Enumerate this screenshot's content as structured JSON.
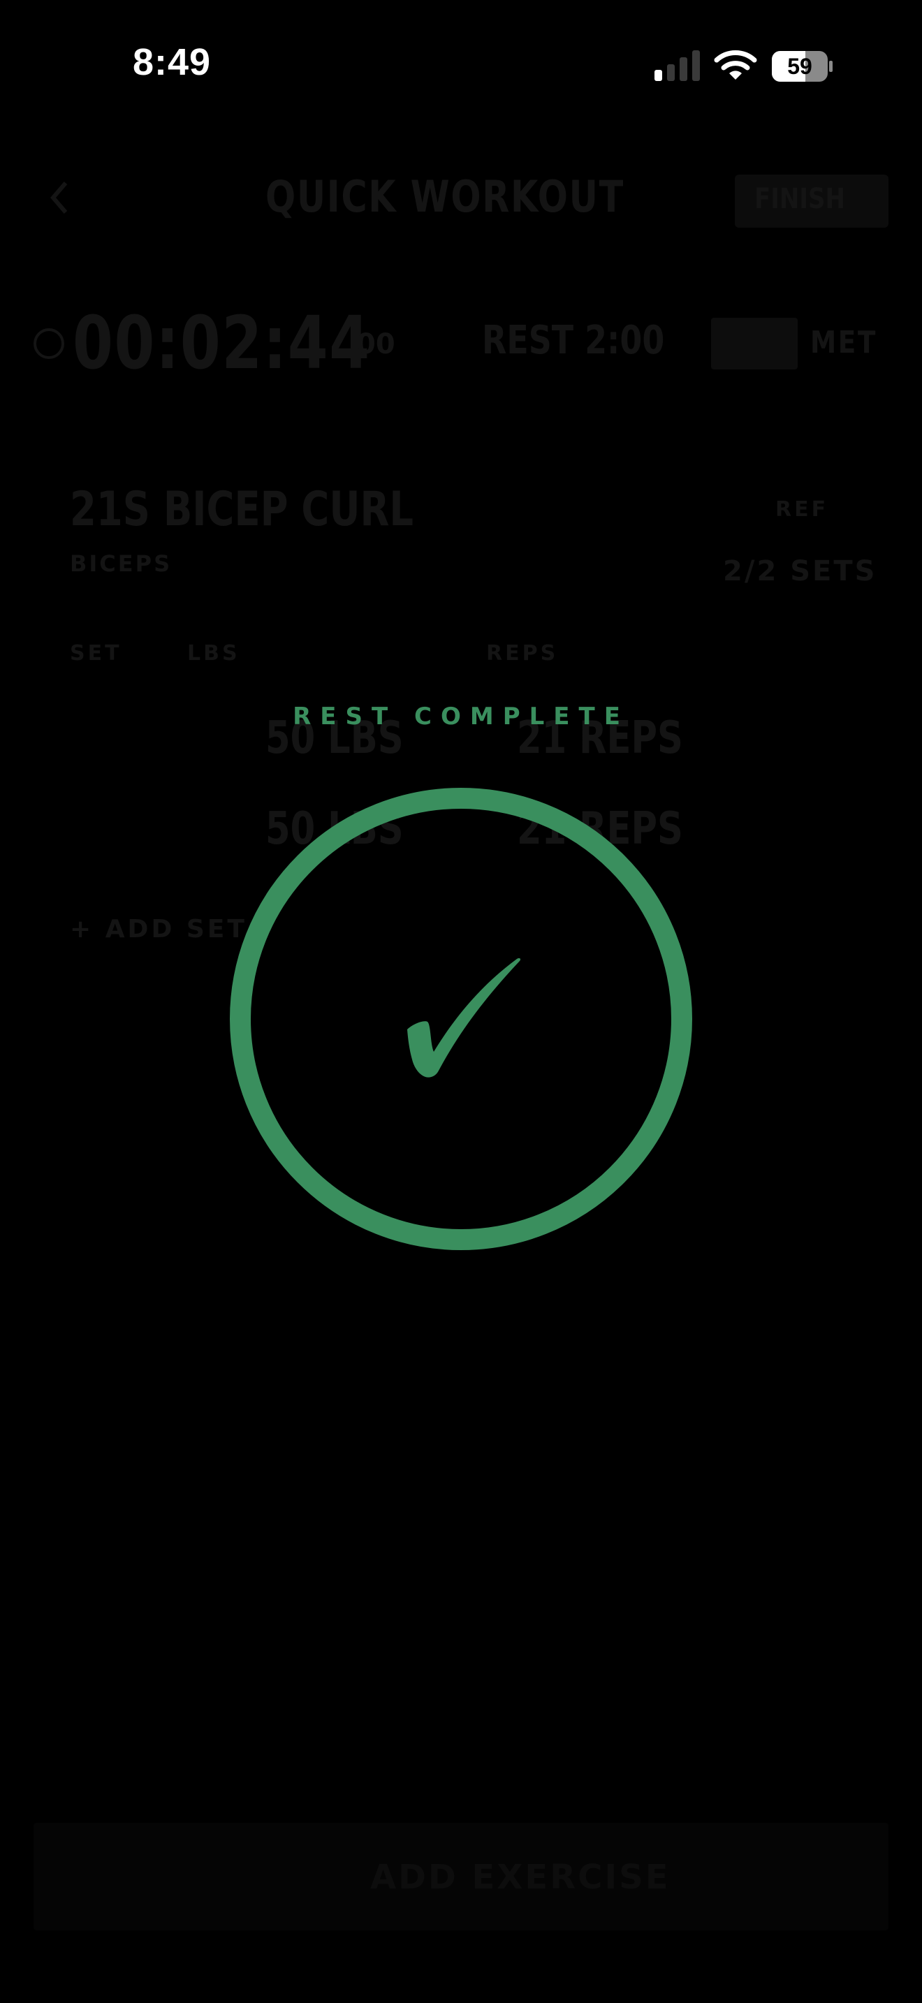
{
  "status_bar": {
    "time": "8:49",
    "battery": "59"
  },
  "background_screen": {
    "header": {
      "title": "QUICK WORKOUT",
      "finish_label": "FINISH"
    },
    "timer": {
      "elapsed": "00:02:44",
      "unit": "00",
      "rest": "REST 2:00",
      "met_label": "MET"
    },
    "exercise": {
      "name": "21S BICEP CURL",
      "sub": "BICEPS",
      "ref_label": "REF",
      "sets_count": "2/2 SETS",
      "columns": [
        "SET",
        "LBS",
        "REPS"
      ],
      "rows": [
        {
          "lbs": "50 LBS",
          "reps": "21 REPS"
        },
        {
          "lbs": "50 LBS",
          "reps": "21 REPS"
        }
      ],
      "add_set": "+ ADD SET"
    },
    "bottom_button": "ADD EXERCISE"
  },
  "overlay": {
    "title": "REST COMPLETE",
    "icon": "checkmark-icon",
    "accent_color": "#3a8f5e"
  }
}
